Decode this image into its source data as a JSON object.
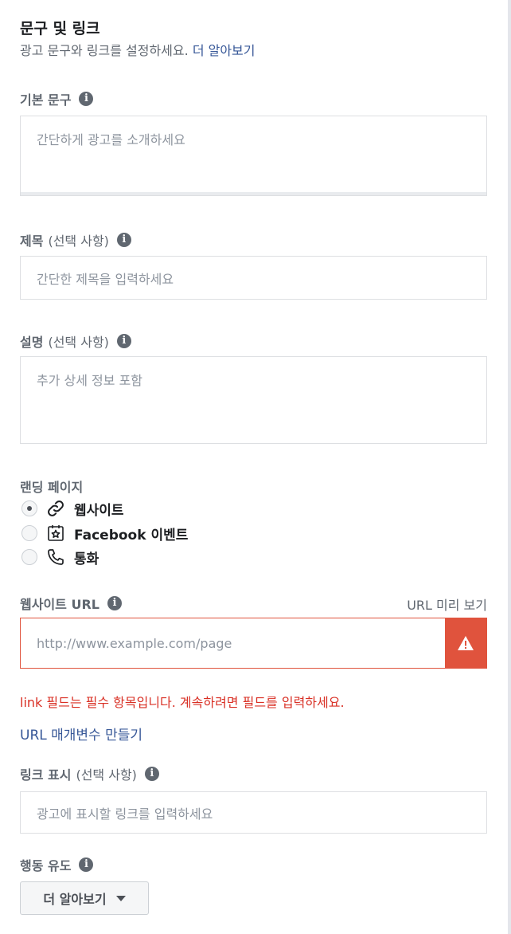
{
  "section": {
    "title": "문구 및 링크",
    "description": "광고 문구와 링크를 설정하세요.",
    "learn_more_link": "더 알아보기"
  },
  "primary_text": {
    "label": "기본 문구",
    "placeholder": "간단하게 광고를 소개하세요"
  },
  "headline": {
    "label": "제목",
    "optional": "(선택 사항)",
    "placeholder": "간단한 제목을 입력하세요"
  },
  "description": {
    "label": "설명",
    "optional": "(선택 사항)",
    "placeholder": "추가 상세 정보 포함"
  },
  "landing_page": {
    "label": "랜딩 페이지",
    "options": [
      {
        "label": "웹사이트",
        "icon": "link-icon",
        "selected": true
      },
      {
        "label": "Facebook 이벤트",
        "icon": "event-star-icon",
        "selected": false
      },
      {
        "label": "통화",
        "icon": "phone-icon",
        "selected": false
      }
    ]
  },
  "website_url": {
    "label": "웹사이트 URL",
    "preview_link": "URL 미리 보기",
    "placeholder": "http://www.example.com/page",
    "error": "link 필드는 필수 항목입니다. 계속하려면 필드를 입력하세요."
  },
  "url_params_link": "URL 매개변수 만들기",
  "display_link": {
    "label": "링크 표시",
    "optional": "(선택 사항)",
    "placeholder": "광고에 표시할 링크를 입력하세요"
  },
  "call_to_action": {
    "label": "행동 유도",
    "selected": "더 알아보기"
  },
  "colors": {
    "error": "#e0533d",
    "link": "#385898"
  }
}
